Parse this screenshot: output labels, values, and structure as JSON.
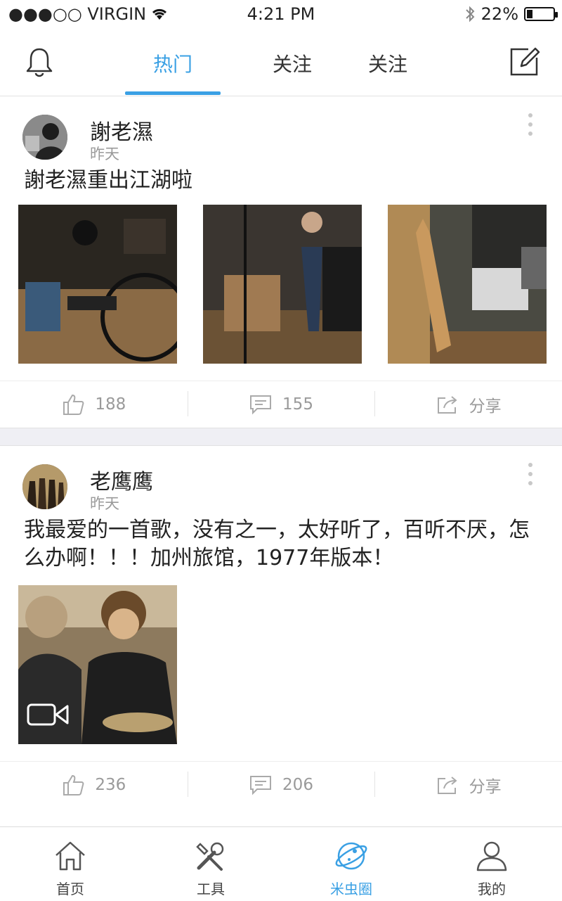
{
  "status_bar": {
    "carrier": "●●●○○ VIRGIN",
    "time": "4:21 PM",
    "battery": "22%"
  },
  "top_nav": {
    "tabs": [
      "热门",
      "关注",
      "关注"
    ]
  },
  "posts": [
    {
      "username": "謝老濕",
      "time": "昨天",
      "text": "謝老濕重出江湖啦",
      "likes": "188",
      "comments": "155",
      "share": "分享"
    },
    {
      "username": "老鹰鹰",
      "time": "昨天",
      "text": "我最爱的一首歌，没有之一，太好听了，百听不厌，怎么办啊！！！加州旅馆，1977年版本！",
      "likes": "236",
      "comments": "206",
      "share": "分享"
    }
  ],
  "bottom_nav": {
    "items": [
      "首页",
      "工具",
      "米虫圈",
      "我的"
    ]
  },
  "colors": {
    "accent": "#3aa0e4",
    "muted": "#9a9a9a",
    "divider": "#efeff4"
  }
}
